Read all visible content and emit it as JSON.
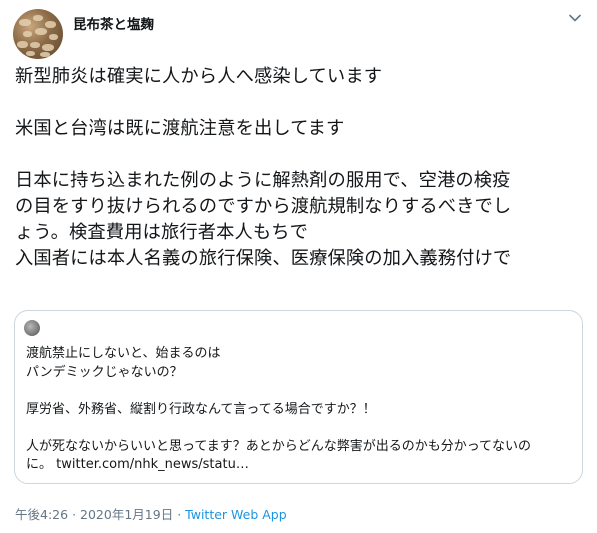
{
  "author": {
    "display_name": "昆布茶と塩麹"
  },
  "tweet": {
    "lines": [
      "新型肺炎は確実に人から人へ感染しています",
      "",
      "米国と台湾は既に渡航注意を出してます",
      "",
      "日本に持ち込まれた例のように解熱剤の服用で、空港の検疫",
      "の目をすり抜けられるのですから渡航規制なりするべきでし",
      "ょう。検査費用は旅行者本人もちで",
      "入国者には本人名義の旅行保険、医療保険の加入義務付けで"
    ]
  },
  "quoted_tweet": {
    "lines": [
      "渡航禁止にしないと、始まるのは",
      "パンデミックじゃないの？",
      "",
      "厚労省、外務省、縦割り行政なんて言ってる場合ですか？！",
      "",
      "人が死なないからいいと思ってます？あとからどんな弊害が出るのかも分かってないの"
    ],
    "last_line_prefix": "に。",
    "link_text": "twitter.com/nhk_news/statu…"
  },
  "meta": {
    "time": "午後4:26",
    "separator": "·",
    "date": "2020年1月19日",
    "source": "Twitter Web App"
  },
  "colors": {
    "text": "#14171a",
    "secondary": "#657786",
    "link": "#1b95e0",
    "border": "#ccd6dd"
  },
  "icons": {
    "menu": "chevron-down-icon"
  }
}
